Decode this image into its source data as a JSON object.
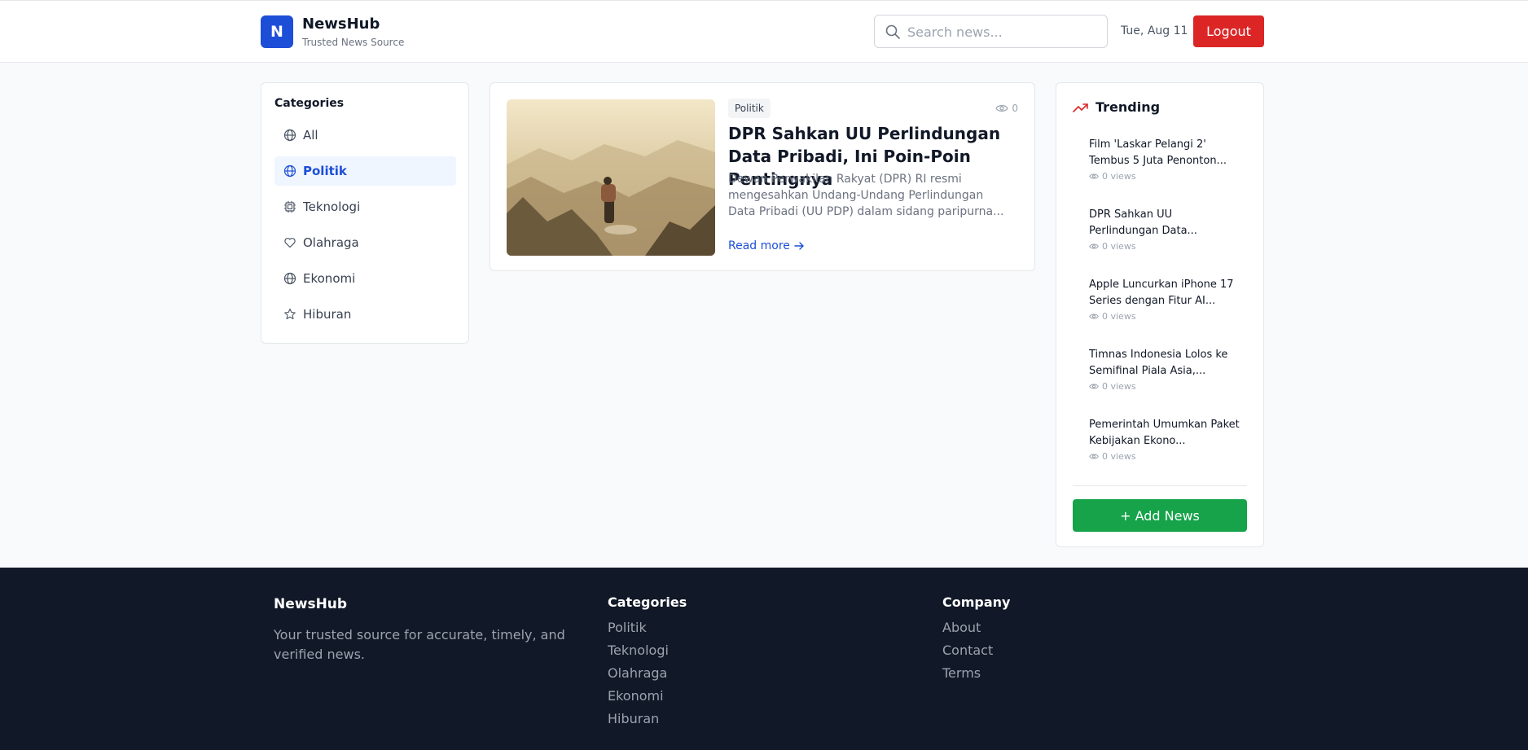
{
  "header": {
    "logo_letter": "N",
    "brand": "NewsHub",
    "tagline": "Trusted News Source",
    "search_placeholder": "Search news...",
    "date": "Tue, Aug 11",
    "logout_label": "Logout"
  },
  "categories": {
    "title": "Categories",
    "items": [
      {
        "label": "All",
        "icon": "globe-icon"
      },
      {
        "label": "Politik",
        "icon": "globe-icon",
        "active": true
      },
      {
        "label": "Teknologi",
        "icon": "cpu-icon"
      },
      {
        "label": "Olahraga",
        "icon": "heart-icon"
      },
      {
        "label": "Ekonomi",
        "icon": "globe-icon"
      },
      {
        "label": "Hiburan",
        "icon": "star-icon"
      }
    ]
  },
  "article": {
    "category": "Politik",
    "views": "0",
    "title": "DPR Sahkan UU Perlindungan Data Pribadi, Ini Poin-Poin Pentingnya",
    "excerpt": "Dewan Perwakilan Rakyat (DPR) RI resmi mengesahkan Undang-Undang Perlindungan Data Pribadi (UU PDP) dalam sidang paripurna...",
    "read_more": "Read more"
  },
  "trending": {
    "title": "Trending",
    "items": [
      {
        "title": "Film 'Laskar Pelangi 2' Tembus 5 Juta Penonton...",
        "views": "0 views"
      },
      {
        "title": "DPR Sahkan UU Perlindungan Data...",
        "views": "0 views"
      },
      {
        "title": "Apple Luncurkan iPhone 17 Series dengan Fitur AI...",
        "views": "0 views"
      },
      {
        "title": "Timnas Indonesia Lolos ke Semifinal Piala Asia,...",
        "views": "0 views"
      },
      {
        "title": "Pemerintah Umumkan Paket Kebijakan Ekono...",
        "views": "0 views"
      }
    ],
    "add_label": "+ Add News"
  },
  "footer": {
    "brand": "NewsHub",
    "description": "Your trusted source for accurate, timely, and verified news.",
    "categories_title": "Categories",
    "categories": [
      "Politik",
      "Teknologi",
      "Olahraga",
      "Ekonomi",
      "Hiburan"
    ],
    "company_title": "Company",
    "company": [
      "About",
      "Contact",
      "Terms"
    ]
  },
  "colors": {
    "primary": "#1d4ed8",
    "logout": "#dc2626",
    "add_news": "#16a34a",
    "footer_bg": "#111827"
  }
}
